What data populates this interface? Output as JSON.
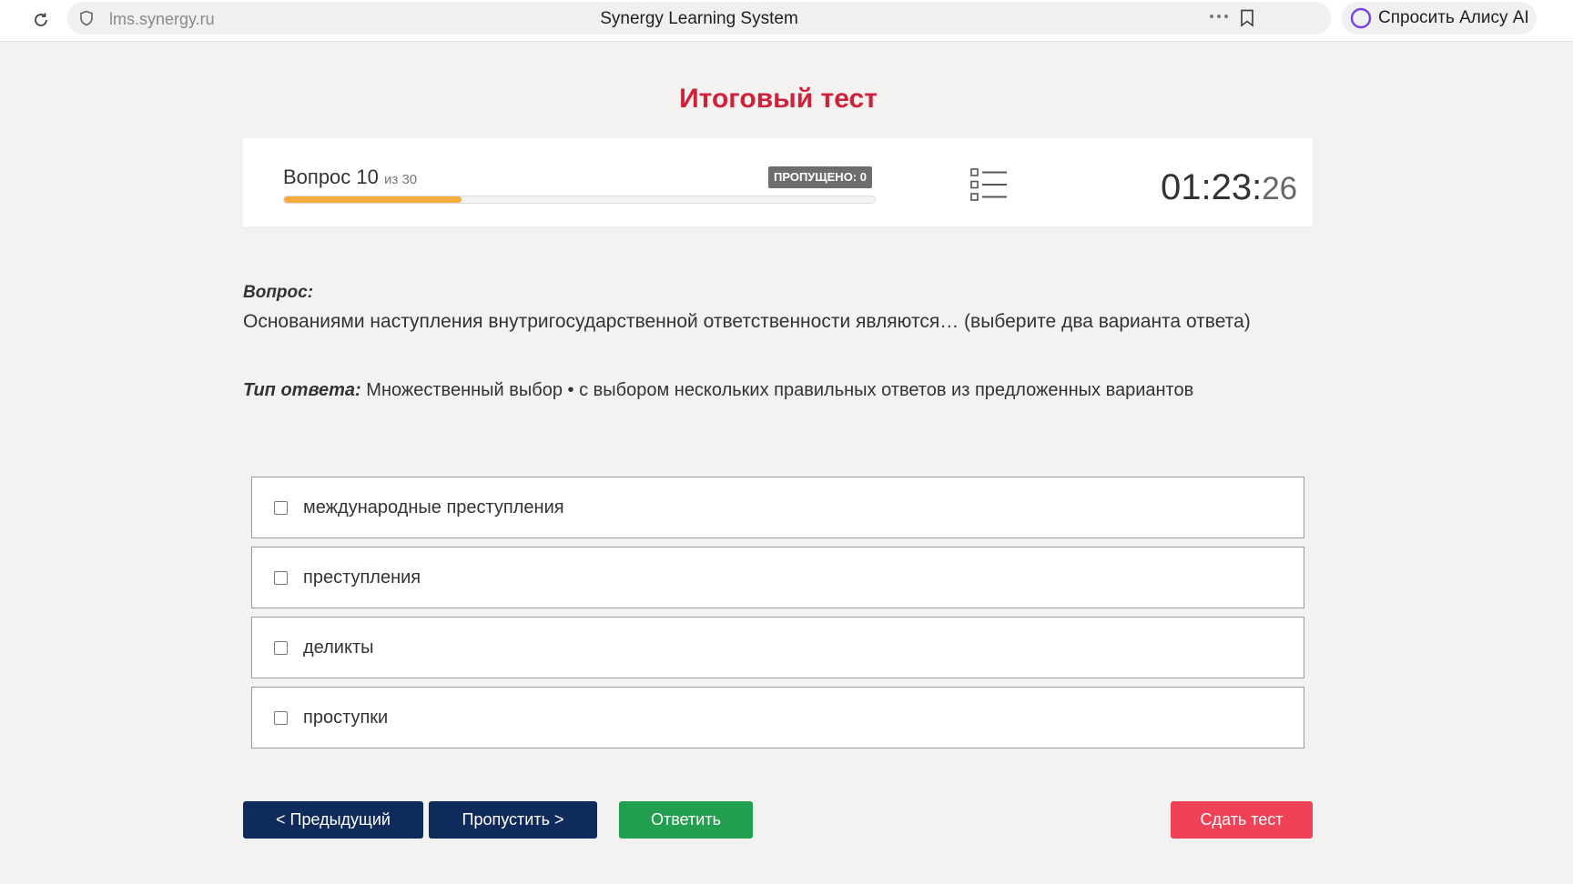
{
  "browser": {
    "url": "lms.synergy.ru",
    "page_title": "Synergy Learning System",
    "alice_label": "Спросить Алису AI"
  },
  "test": {
    "title": "Итоговый тест",
    "question_word": "Вопрос 10",
    "question_of": "из 30",
    "question_current": 10,
    "question_total": 30,
    "progress_fraction": 0.3,
    "skipped_badge": "ПРОПУЩЕНО: 0",
    "timer_main": "01:23:",
    "timer_seconds": "26"
  },
  "question": {
    "label": "Вопрос:",
    "text": "Основаниями наступления внутригосударственной ответственности являются… (выберите два варианта ответа)",
    "answer_type_label": "Тип ответа:",
    "answer_type_value": "Множественный выбор • с выбором нескольких правильных ответов из предложенных вариантов"
  },
  "options": [
    {
      "label": "международные преступления",
      "checked": false
    },
    {
      "label": "преступления",
      "checked": false
    },
    {
      "label": "деликты",
      "checked": false
    },
    {
      "label": "проступки",
      "checked": false
    }
  ],
  "buttons": {
    "prev": "< Предыдущий",
    "skip": "Пропустить >",
    "answer": "Ответить",
    "submit": "Сдать тест"
  },
  "colors": {
    "title_red": "#d0213b",
    "nav_blue": "#0f2b5b",
    "answer_green": "#22a04f",
    "submit_red": "#ef4257",
    "progress_orange": "#f4ad3d"
  }
}
